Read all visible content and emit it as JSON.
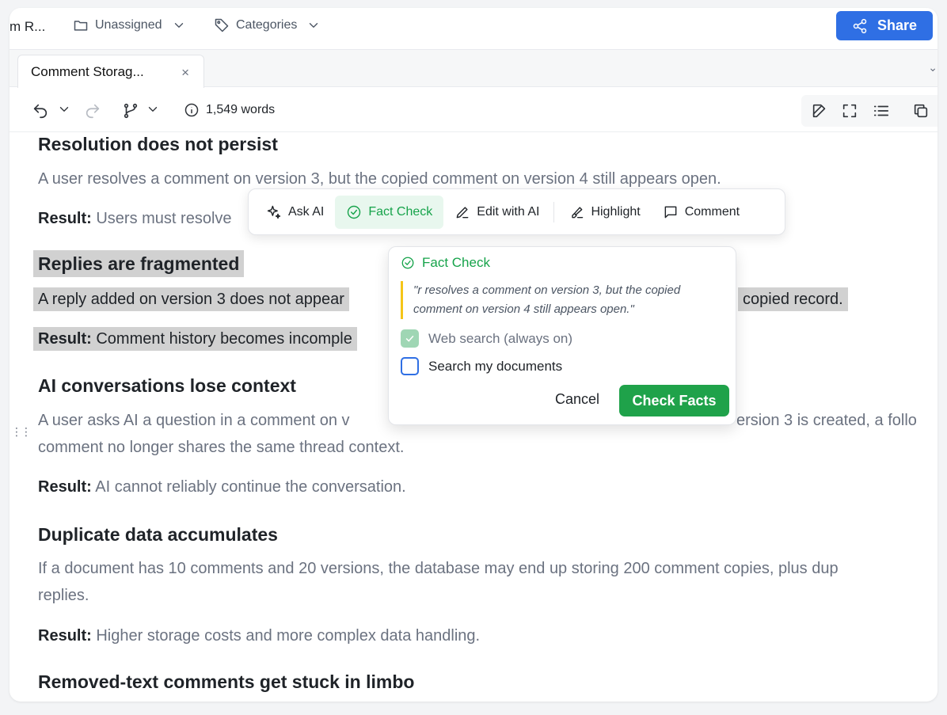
{
  "topbar": {
    "doc_title": "m R...",
    "assign_label": "Unassigned",
    "categories_label": "Categories",
    "share_label": "Share"
  },
  "tab": {
    "label": "Comment Storag...",
    "close": "×"
  },
  "toolbar": {
    "word_count": "1,549 words"
  },
  "content": {
    "h_resolution": "Resolution does not persist",
    "p_resolution": "A user resolves a comment on version 3, but the copied comment on version 4 still appears open.",
    "r_resolution_label": "Result:",
    "r_resolution_text": " Users must resolve",
    "h_replies": "Replies are fragmented",
    "p_replies_a": "A reply added on version 3 does not appear",
    "p_replies_b": "copied record.",
    "r_replies_label": "Result:",
    "r_replies_text": " Comment history becomes incomple",
    "h_ai": "AI conversations lose context",
    "p_ai_1a": "A user asks AI a question in a comment on v",
    "p_ai_1b": "ersion 3 is created, a follo",
    "p_ai_2": "comment no longer shares the same thread context.",
    "r_ai_label": "Result:",
    "r_ai_text": " AI cannot reliably continue the conversation.",
    "h_dup": "Duplicate data accumulates",
    "p_dup_1": "If a document has 10 comments and 20 versions, the database may end up storing 200 comment copies, plus dup",
    "p_dup_2": "replies.",
    "r_dup_label": "Result:",
    "r_dup_text": " Higher storage costs and more complex data handling.",
    "h_removed": "Removed-text comments get stuck in limbo"
  },
  "selection_toolbar": {
    "ask_ai": "Ask AI",
    "fact_check": "Fact Check",
    "edit_ai": "Edit with AI",
    "highlight": "Highlight",
    "comment": "Comment"
  },
  "fact_check_popover": {
    "title": "Fact Check",
    "quote": "\"r resolves a comment on version 3, but the copied comment on version 4 still appears open.\"",
    "web_search_label": "Web search (always on)",
    "web_search_checked": true,
    "my_docs_label": "Search my documents",
    "my_docs_checked": false,
    "cancel_label": "Cancel",
    "submit_label": "Check Facts"
  },
  "colors": {
    "accent_blue": "#2f6fe4",
    "success_green": "#1fa24a",
    "highlight_gray": "#d1d1d1",
    "quote_bar_yellow": "#f5c518"
  }
}
